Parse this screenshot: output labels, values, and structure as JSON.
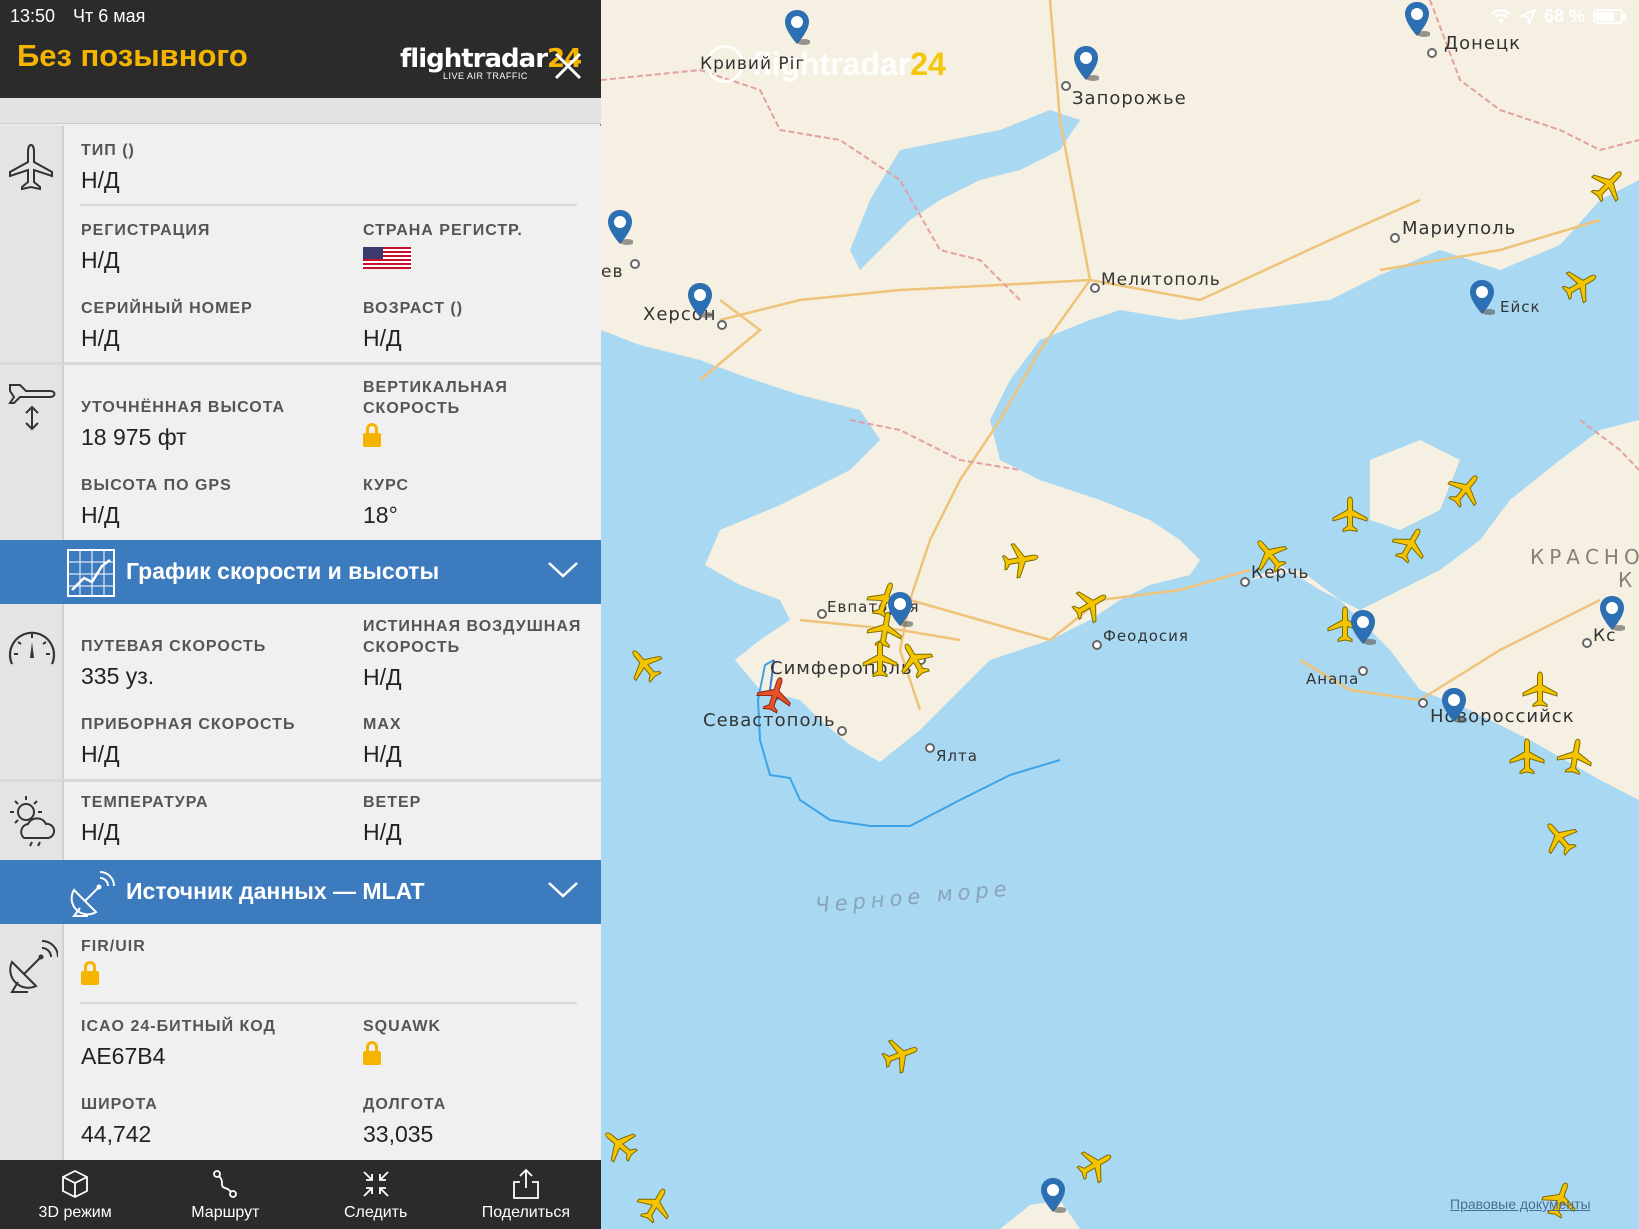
{
  "status_bar": {
    "time": "13:50",
    "date": "Чт 6 мая",
    "battery": "68 %"
  },
  "header": {
    "callsign": "Без позывного",
    "brand_main": "flightradar",
    "brand_num": "24",
    "brand_sub": "LIVE AIR TRAFFIC"
  },
  "aircraft": {
    "type_label": "ТИП ()",
    "type_value": "Н/Д",
    "reg_label": "РЕГИСТРАЦИЯ",
    "reg_value": "Н/Д",
    "country_label": "СТРАНА РЕГИСТР.",
    "country_flag": "us-flag",
    "serial_label": "СЕРИЙНЫЙ НОМЕР",
    "serial_value": "Н/Д",
    "age_label": "ВОЗРАСТ ()",
    "age_value": "Н/Д"
  },
  "altitude": {
    "calibrated_label": "УТОЧНЁННАЯ ВЫСОТА",
    "calibrated_value": "18 975 фт",
    "vspeed_label1": "ВЕРТИКАЛЬНАЯ",
    "vspeed_label2": "СКОРОСТЬ",
    "gps_label": "ВЫСОТА ПО GPS",
    "gps_value": "Н/Д",
    "course_label": "КУРС",
    "course_value": "18°"
  },
  "graph_bar": {
    "title": "График скорости и высоты"
  },
  "speed": {
    "ground_label": "ПУТЕВАЯ СКОРОСТЬ",
    "ground_value": "335 уз.",
    "tas_label1": "ИСТИННАЯ ВОЗДУШНАЯ",
    "tas_label2": "СКОРОСТЬ",
    "tas_value": "Н/Д",
    "ias_label": "ПРИБОРНАЯ СКОРОСТЬ",
    "ias_value": "Н/Д",
    "mach_label": "MAX",
    "mach_value": "Н/Д"
  },
  "weather": {
    "temp_label": "ТЕМПЕРАТУРА",
    "temp_value": "Н/Д",
    "wind_label": "ВЕТЕР",
    "wind_value": "Н/Д"
  },
  "source_bar": {
    "title": "Источник данных — MLAT"
  },
  "source": {
    "fir_label": "FIR/UIR",
    "icao_label": "ICAO 24-БИТНЫЙ КОД",
    "icao_value": "AE67B4",
    "squawk_label": "SQUAWK",
    "lat_label": "ШИРОТА",
    "lat_value": "44,742",
    "lon_label": "ДОЛГОТА",
    "lon_value": "33,035"
  },
  "toolbar": {
    "mode3d": "3D режим",
    "route": "Маршрут",
    "follow": "Следить",
    "share": "Поделиться"
  },
  "map": {
    "logo_main": "flightradar",
    "logo_num": "24",
    "cities": {
      "donetsk": "Донецк",
      "zaporozhye": "Запорожье",
      "mariupol": "Мариуполь",
      "melitopol": "Мелитополь",
      "kherson": "Херсон",
      "nikolaev": "ев",
      "yeysk": "Ейск",
      "krasnodar": "КРАСНО",
      "krasnodar2": "К",
      "kerch": "Керчь",
      "evpatoria": "Евпатория",
      "feodosia": "Феодосия",
      "simferopol": "Симферополь",
      "sevastopol": "Севастополь",
      "yalta": "Ялта",
      "anapa": "Анапа",
      "novorossiysk": "Новороссийск",
      "kryvyi": "Кривий Ріг",
      "black_sea": "Черное море",
      "kc": "Кс"
    },
    "legal": "Правовые документы"
  },
  "colors": {
    "accent": "#f5b400",
    "bar_blue": "#3d7bbf",
    "header_dark": "#2b2b2b"
  }
}
